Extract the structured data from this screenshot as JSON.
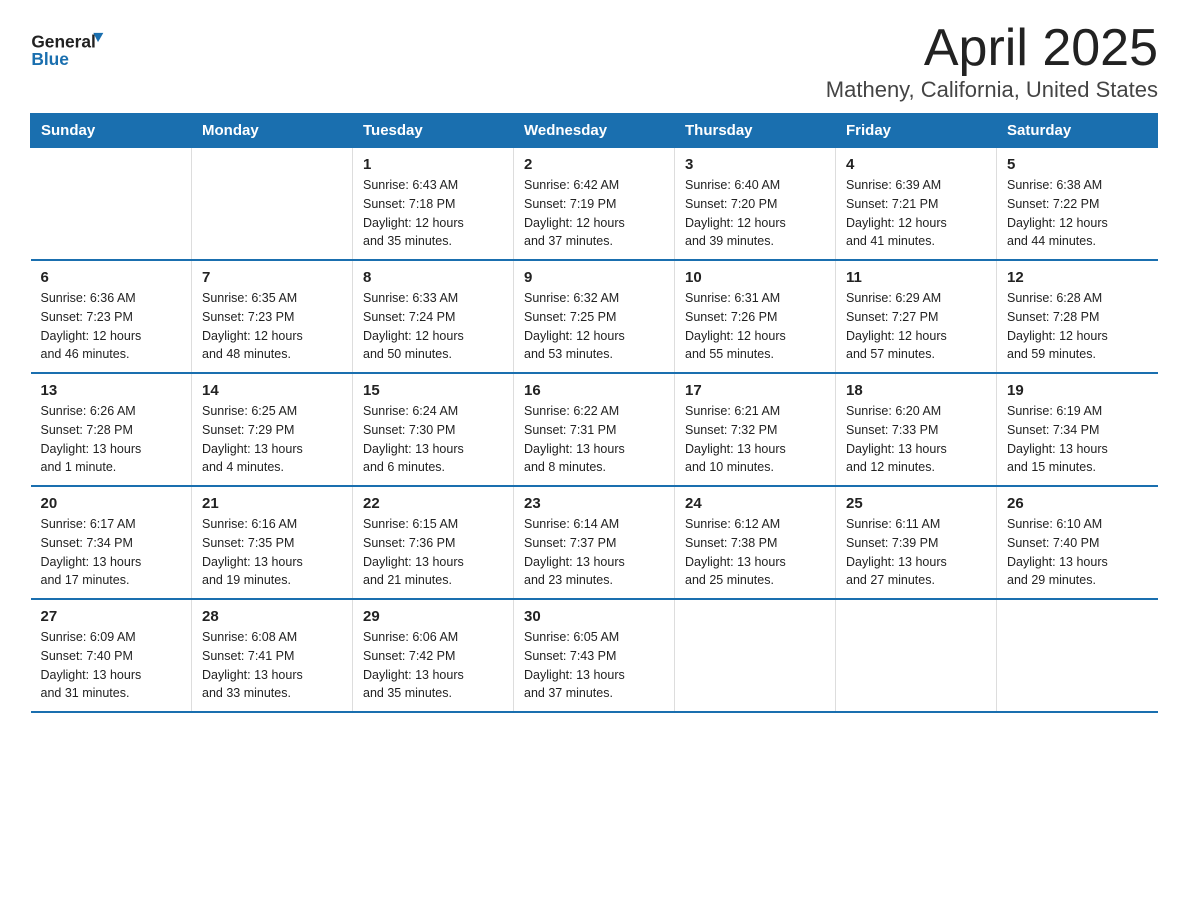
{
  "header": {
    "title": "April 2025",
    "subtitle": "Matheny, California, United States",
    "logo_general": "General",
    "logo_blue": "Blue"
  },
  "days_of_week": [
    "Sunday",
    "Monday",
    "Tuesday",
    "Wednesday",
    "Thursday",
    "Friday",
    "Saturday"
  ],
  "weeks": [
    [
      {
        "day": "",
        "info": ""
      },
      {
        "day": "",
        "info": ""
      },
      {
        "day": "1",
        "info": "Sunrise: 6:43 AM\nSunset: 7:18 PM\nDaylight: 12 hours\nand 35 minutes."
      },
      {
        "day": "2",
        "info": "Sunrise: 6:42 AM\nSunset: 7:19 PM\nDaylight: 12 hours\nand 37 minutes."
      },
      {
        "day": "3",
        "info": "Sunrise: 6:40 AM\nSunset: 7:20 PM\nDaylight: 12 hours\nand 39 minutes."
      },
      {
        "day": "4",
        "info": "Sunrise: 6:39 AM\nSunset: 7:21 PM\nDaylight: 12 hours\nand 41 minutes."
      },
      {
        "day": "5",
        "info": "Sunrise: 6:38 AM\nSunset: 7:22 PM\nDaylight: 12 hours\nand 44 minutes."
      }
    ],
    [
      {
        "day": "6",
        "info": "Sunrise: 6:36 AM\nSunset: 7:23 PM\nDaylight: 12 hours\nand 46 minutes."
      },
      {
        "day": "7",
        "info": "Sunrise: 6:35 AM\nSunset: 7:23 PM\nDaylight: 12 hours\nand 48 minutes."
      },
      {
        "day": "8",
        "info": "Sunrise: 6:33 AM\nSunset: 7:24 PM\nDaylight: 12 hours\nand 50 minutes."
      },
      {
        "day": "9",
        "info": "Sunrise: 6:32 AM\nSunset: 7:25 PM\nDaylight: 12 hours\nand 53 minutes."
      },
      {
        "day": "10",
        "info": "Sunrise: 6:31 AM\nSunset: 7:26 PM\nDaylight: 12 hours\nand 55 minutes."
      },
      {
        "day": "11",
        "info": "Sunrise: 6:29 AM\nSunset: 7:27 PM\nDaylight: 12 hours\nand 57 minutes."
      },
      {
        "day": "12",
        "info": "Sunrise: 6:28 AM\nSunset: 7:28 PM\nDaylight: 12 hours\nand 59 minutes."
      }
    ],
    [
      {
        "day": "13",
        "info": "Sunrise: 6:26 AM\nSunset: 7:28 PM\nDaylight: 13 hours\nand 1 minute."
      },
      {
        "day": "14",
        "info": "Sunrise: 6:25 AM\nSunset: 7:29 PM\nDaylight: 13 hours\nand 4 minutes."
      },
      {
        "day": "15",
        "info": "Sunrise: 6:24 AM\nSunset: 7:30 PM\nDaylight: 13 hours\nand 6 minutes."
      },
      {
        "day": "16",
        "info": "Sunrise: 6:22 AM\nSunset: 7:31 PM\nDaylight: 13 hours\nand 8 minutes."
      },
      {
        "day": "17",
        "info": "Sunrise: 6:21 AM\nSunset: 7:32 PM\nDaylight: 13 hours\nand 10 minutes."
      },
      {
        "day": "18",
        "info": "Sunrise: 6:20 AM\nSunset: 7:33 PM\nDaylight: 13 hours\nand 12 minutes."
      },
      {
        "day": "19",
        "info": "Sunrise: 6:19 AM\nSunset: 7:34 PM\nDaylight: 13 hours\nand 15 minutes."
      }
    ],
    [
      {
        "day": "20",
        "info": "Sunrise: 6:17 AM\nSunset: 7:34 PM\nDaylight: 13 hours\nand 17 minutes."
      },
      {
        "day": "21",
        "info": "Sunrise: 6:16 AM\nSunset: 7:35 PM\nDaylight: 13 hours\nand 19 minutes."
      },
      {
        "day": "22",
        "info": "Sunrise: 6:15 AM\nSunset: 7:36 PM\nDaylight: 13 hours\nand 21 minutes."
      },
      {
        "day": "23",
        "info": "Sunrise: 6:14 AM\nSunset: 7:37 PM\nDaylight: 13 hours\nand 23 minutes."
      },
      {
        "day": "24",
        "info": "Sunrise: 6:12 AM\nSunset: 7:38 PM\nDaylight: 13 hours\nand 25 minutes."
      },
      {
        "day": "25",
        "info": "Sunrise: 6:11 AM\nSunset: 7:39 PM\nDaylight: 13 hours\nand 27 minutes."
      },
      {
        "day": "26",
        "info": "Sunrise: 6:10 AM\nSunset: 7:40 PM\nDaylight: 13 hours\nand 29 minutes."
      }
    ],
    [
      {
        "day": "27",
        "info": "Sunrise: 6:09 AM\nSunset: 7:40 PM\nDaylight: 13 hours\nand 31 minutes."
      },
      {
        "day": "28",
        "info": "Sunrise: 6:08 AM\nSunset: 7:41 PM\nDaylight: 13 hours\nand 33 minutes."
      },
      {
        "day": "29",
        "info": "Sunrise: 6:06 AM\nSunset: 7:42 PM\nDaylight: 13 hours\nand 35 minutes."
      },
      {
        "day": "30",
        "info": "Sunrise: 6:05 AM\nSunset: 7:43 PM\nDaylight: 13 hours\nand 37 minutes."
      },
      {
        "day": "",
        "info": ""
      },
      {
        "day": "",
        "info": ""
      },
      {
        "day": "",
        "info": ""
      }
    ]
  ],
  "colors": {
    "header_bg": "#1a6faf",
    "header_text": "#ffffff",
    "accent": "#1a6faf"
  }
}
